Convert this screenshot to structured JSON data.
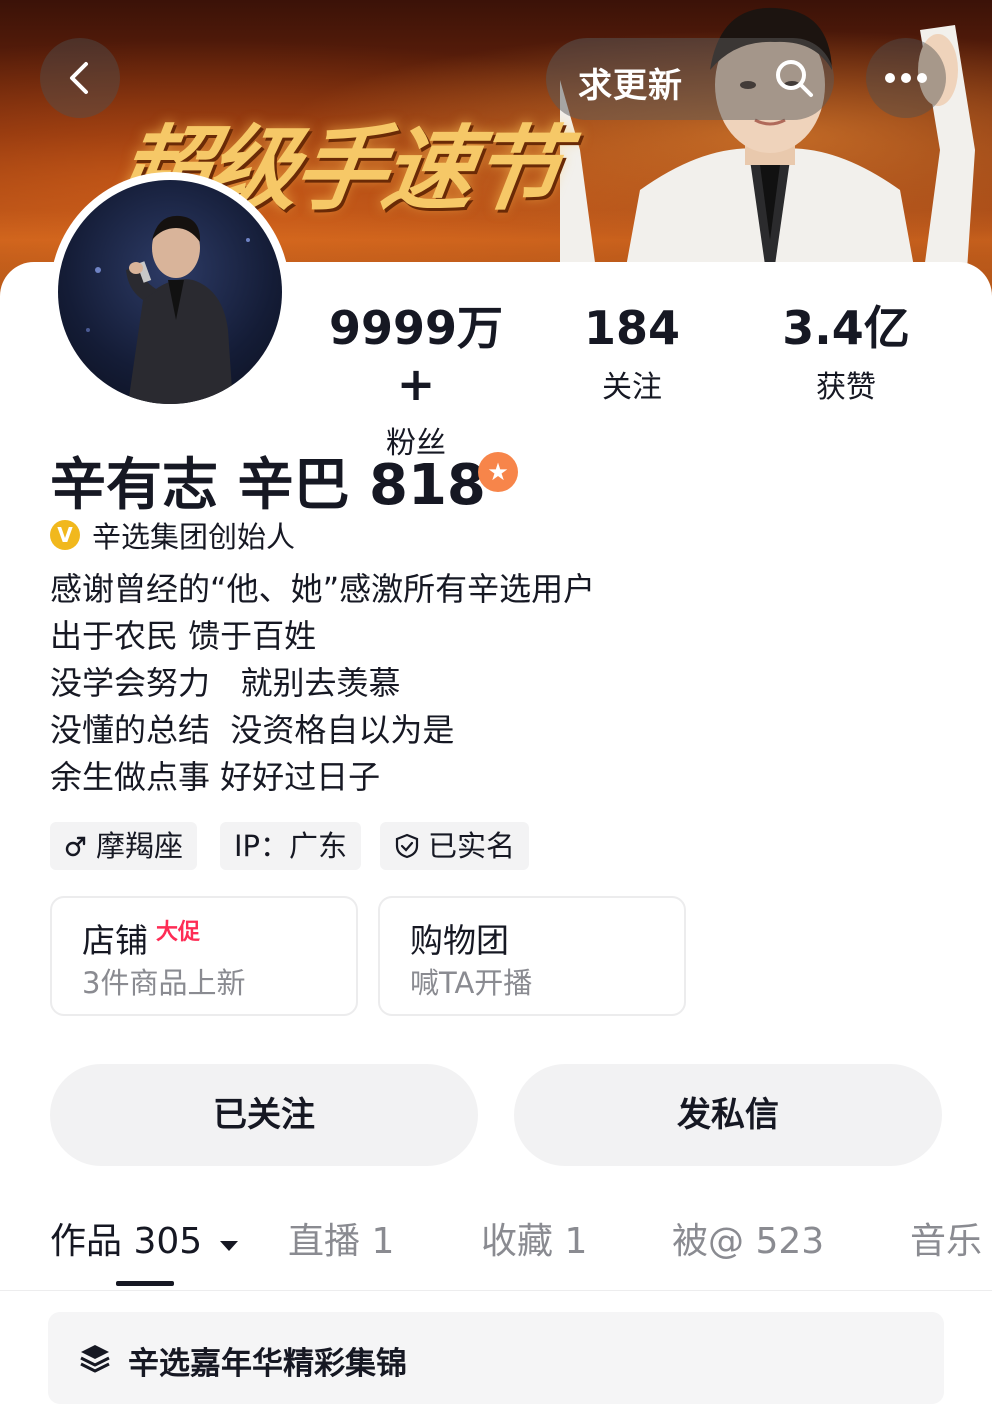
{
  "header": {
    "banner_title": "超级手速节",
    "request_update_label": "求更新",
    "back_icon": "chevron-left-icon",
    "search_icon": "search-icon",
    "more_icon": "more-icon"
  },
  "stats": [
    {
      "value": "9999万+",
      "label": "粉丝"
    },
    {
      "value": "184",
      "label": "关注"
    },
    {
      "value": "3.4亿",
      "label": "获赞"
    }
  ],
  "profile": {
    "name": "辛有志 辛巴 818",
    "badge_icon": "star-icon",
    "verify_mark": "V",
    "verify_text": "辛选集团创始人",
    "bio_lines": [
      "感谢曾经的“他、她”感激所有辛选用户",
      "出于农民 馈于百姓",
      "没学会努力   就别去羡慕",
      "没懂的总结  没资格自以为是",
      "余生做点事 好好过日子"
    ],
    "tags": [
      {
        "icon": "male-icon",
        "text": "摩羯座"
      },
      {
        "icon": "",
        "text": "IP：广东"
      },
      {
        "icon": "shield-check-icon",
        "text": "已实名"
      }
    ]
  },
  "cards": [
    {
      "title": "店铺",
      "badge": "大促",
      "subtitle": "3件商品上新"
    },
    {
      "title": "购物团",
      "badge": "",
      "subtitle": "喊TA开播"
    }
  ],
  "actions": {
    "followed_label": "已关注",
    "message_label": "发私信"
  },
  "tabs": [
    {
      "label": "作品 305"
    },
    {
      "label": "直播 1"
    },
    {
      "label": "收藏 1"
    },
    {
      "label": "被@ 523"
    },
    {
      "label": "音乐"
    }
  ],
  "collection": {
    "icon": "layers-icon",
    "label": "辛选嘉年华精彩集锦"
  },
  "colors": {
    "accent_orange": "#f7854a",
    "verify_gold": "#f1b81d",
    "promo_red": "#fe2c55"
  }
}
